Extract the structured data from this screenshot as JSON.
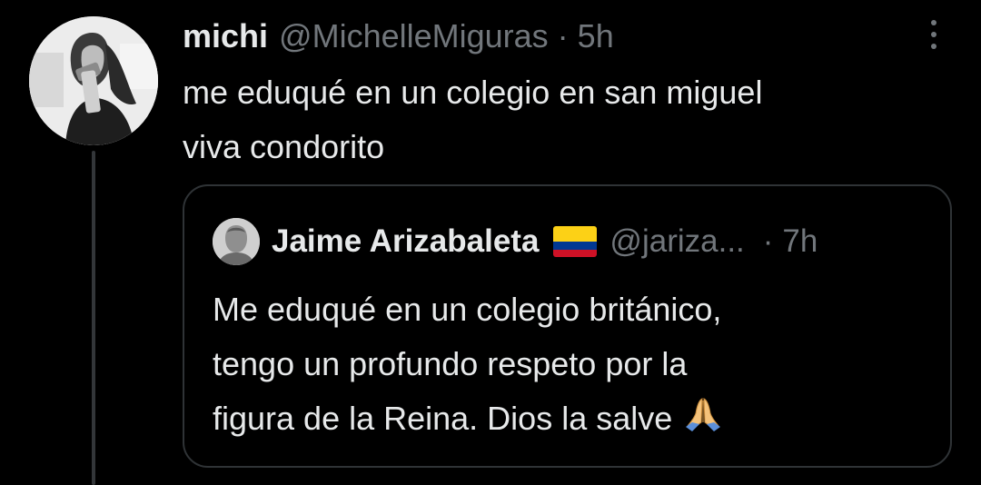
{
  "tweet": {
    "display_name": "michi",
    "handle": "@MichelleMiguras",
    "separator": "·",
    "time": "5h",
    "text_lines": [
      "me eduqué en un colegio en san miguel",
      "viva condorito"
    ],
    "more_icon": "more-vertical-icon",
    "avatar_icon": "user-avatar-photo"
  },
  "quoted": {
    "display_name": "Jaime Arizabaleta",
    "flag_icon": "colombia-flag-icon",
    "handle": "@jariza...",
    "separator": "·",
    "time": "7h",
    "text_lines": [
      "Me eduqué en un colegio británico,",
      "tengo un profundo respeto por la",
      "figura de la Reina. Dios la salve"
    ],
    "emoji_icon": "folded-hands-icon",
    "avatar_icon": "user-avatar-photo"
  },
  "colors": {
    "background": "#000000",
    "primary_text": "#e7e9ea",
    "secondary_text": "#71767b",
    "border": "#2f3336",
    "thread_line": "#333639"
  }
}
